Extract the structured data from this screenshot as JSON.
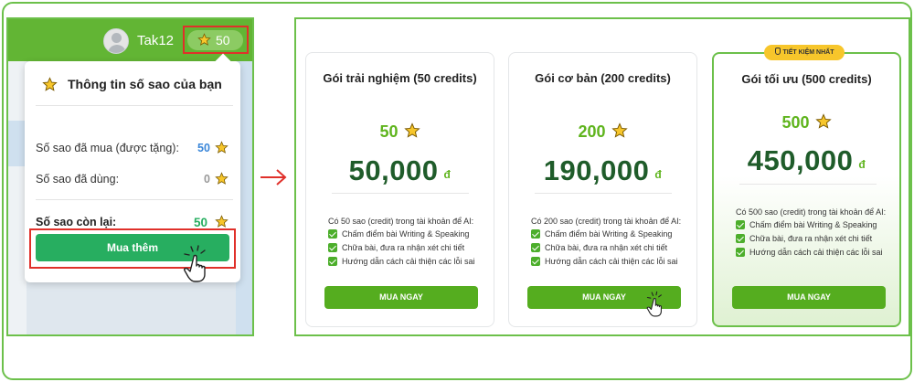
{
  "header": {
    "username": "Tak12",
    "star_count": "50"
  },
  "popup": {
    "title": "Thông tin số sao của bạn",
    "rows": [
      {
        "label": "Số sao đã mua (được tặng):",
        "value": "50",
        "color": "#3a86d8"
      },
      {
        "label": "Số sao đã dùng:",
        "value": "0",
        "color": "#999999"
      },
      {
        "label": "Số sao còn lại:",
        "value": "50",
        "color": "#27ae60"
      }
    ],
    "buy_more_label": "Mua thêm"
  },
  "plans": [
    {
      "title": "Gói trải nghiệm (50 credits)",
      "credits": "50",
      "price": "50,000",
      "currency": "đ",
      "description": "Có 50 sao (credit) trong tài khoản để AI:",
      "features": [
        "Chấm điểm bài Writing & Speaking",
        "Chữa bài, đưa ra nhận xét chi tiết",
        "Hướng dẫn cách cải thiện các lỗi sai"
      ],
      "button": "MUA NGAY"
    },
    {
      "title": "Gói cơ bản (200 credits)",
      "credits": "200",
      "price": "190,000",
      "currency": "đ",
      "description": "Có 200 sao (credit) trong tài khoản để AI:",
      "features": [
        "Chấm điểm bài Writing & Speaking",
        "Chữa bài, đưa ra nhận xét chi tiết",
        "Hướng dẫn cách cải thiện các lỗi sai"
      ],
      "button": "MUA NGAY"
    },
    {
      "title": "Gói tối ưu (500 credits)",
      "credits": "500",
      "price": "450,000",
      "currency": "đ",
      "description": "Có 500 sao (credit) trong tài khoản để AI:",
      "features": [
        "Chấm điểm bài Writing & Speaking",
        "Chữa bài, đưa ra nhận xét chi tiết",
        "Hướng dẫn cách cải thiện các lỗi sai"
      ],
      "button": "MUA NGAY",
      "badge": "TIẾT KIỆM NHẤT"
    }
  ],
  "icons": {
    "star": "star-icon",
    "cursor": "hand-pointer-icon",
    "arrow": "arrow-right-icon",
    "check": "checkbox-icon",
    "badge": "medal-icon"
  },
  "colors": {
    "brand_green": "#62b534",
    "button_green": "#55ad1f",
    "price_dark": "#1f5c2a",
    "highlight_red": "#e0302a",
    "badge_yellow": "#f7c62b"
  }
}
